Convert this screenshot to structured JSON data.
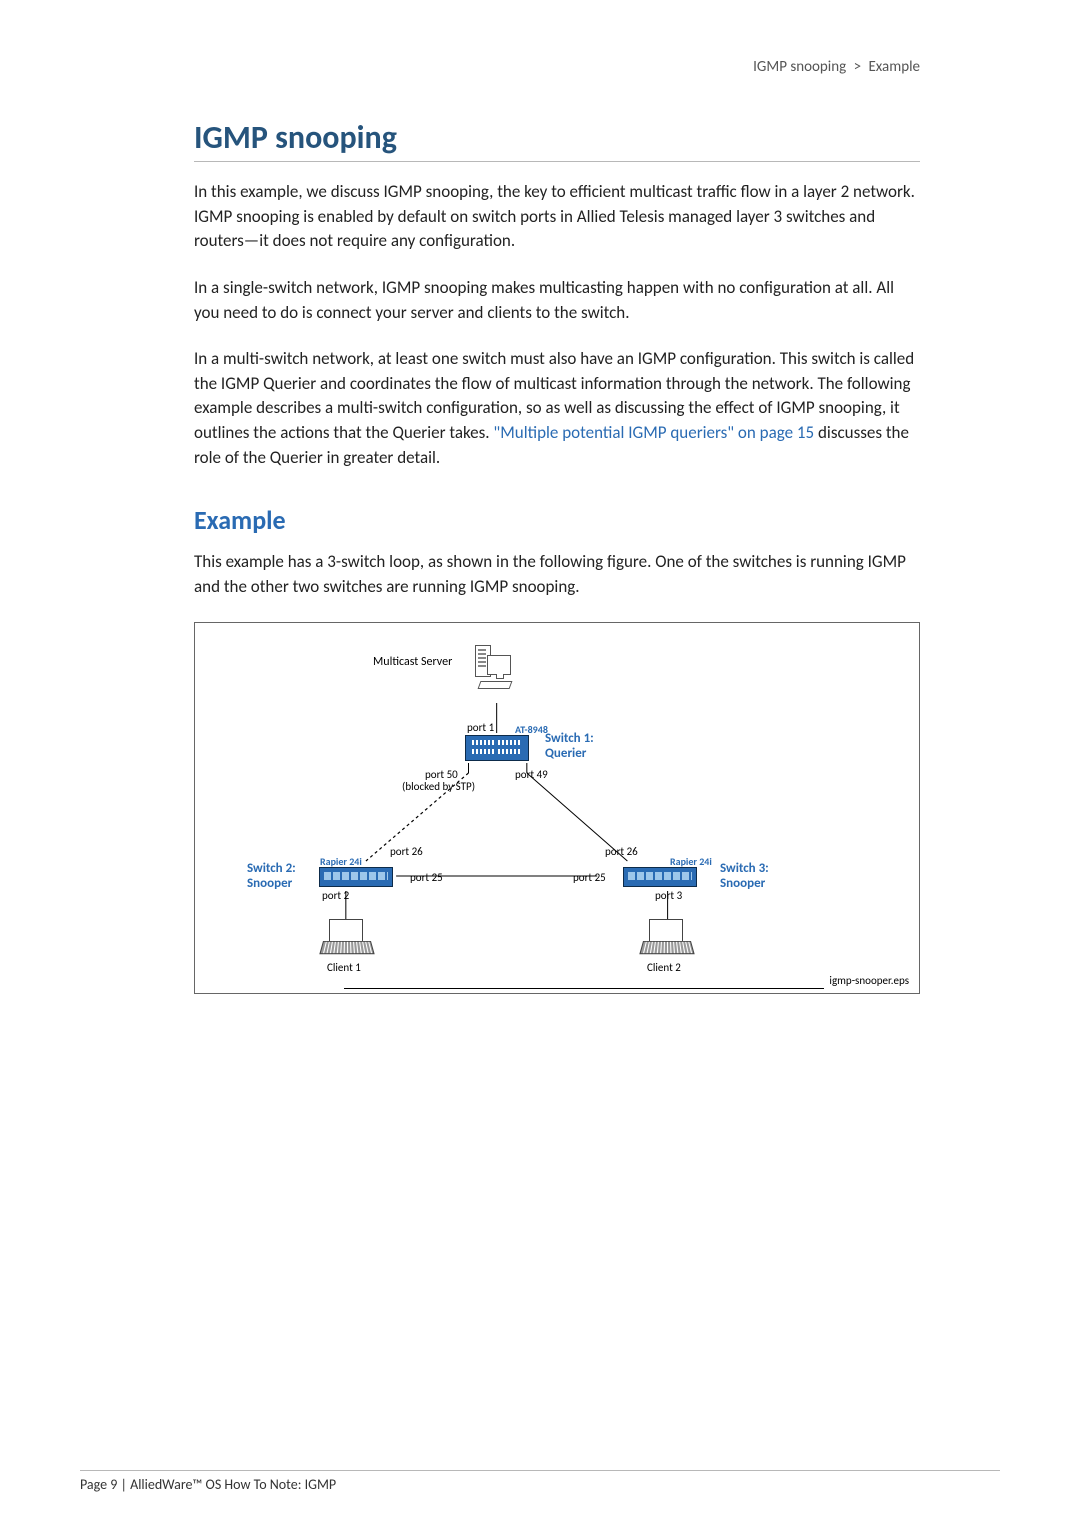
{
  "breadcrumb": {
    "section": "IGMP snooping",
    "sep": ">",
    "sub": "Example"
  },
  "h1": "IGMP snooping",
  "p1": "In this example, we discuss IGMP snooping, the key to efficient multicast traffic flow in a layer 2 network. IGMP snooping is enabled by default on switch ports in Allied Telesis managed layer 3 switches and routers—it does not require any configuration.",
  "p2": "In a single-switch network, IGMP snooping makes multicasting happen with no configuration at all. All you need to do is connect your server and clients to the switch.",
  "p3a": "In a multi-switch network, at least one switch must also have an IGMP configuration. This switch is called the IGMP Querier and coordinates the flow of multicast information through the network. The following example describes a multi-switch configuration, so as well as discussing the effect of IGMP snooping, it outlines the actions that the Querier takes. ",
  "p3link": "\"Multiple potential IGMP queriers\" on page 15",
  "p3b": " discusses the role of the Querier in greater detail.",
  "h2": "Example",
  "p4": "This example has a 3-switch loop, as shown in the following figure. One of the switches is running IGMP and the other two switches are running IGMP snooping.",
  "figure": {
    "multicast_server": "Multicast Server",
    "port1": "port 1",
    "at8948": "AT-8948",
    "switch1": "Switch 1:\nQuerier",
    "port50": "port 50",
    "blocked": "(blocked by STP)",
    "port49": "port 49",
    "port26_l": "port 26",
    "port26_r": "port 26",
    "port25_l": "port 25",
    "port25_r": "port 25",
    "rapier_l": "Rapier 24i",
    "rapier_r": "Rapier 24i",
    "switch2": "Switch 2:\nSnooper",
    "switch3": "Switch 3:\nSnooper",
    "port2": "port 2",
    "port3": "port 3",
    "client1": "Client 1",
    "client2": "Client 2",
    "filename": "igmp-snooper.eps"
  },
  "footer": "Page 9 | AlliedWare™ OS How To Note: IGMP"
}
